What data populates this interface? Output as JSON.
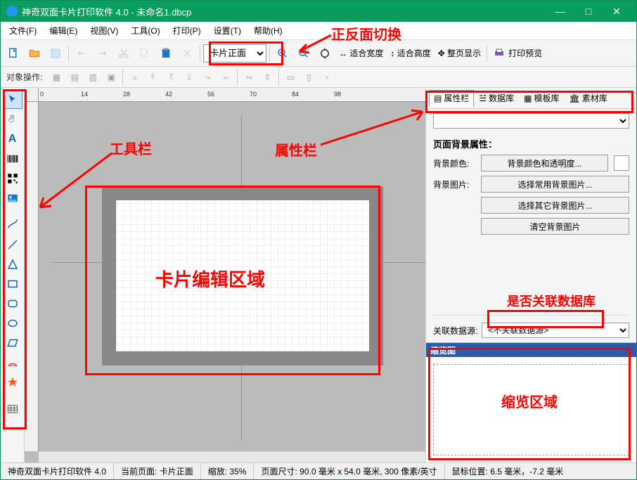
{
  "title": "神奇双面卡片打印软件 4.0 - 未命名1.dbcp",
  "menus": [
    "文件(F)",
    "编辑(E)",
    "视图(V)",
    "工具(O)",
    "打印(P)",
    "设置(T)",
    "帮助(H)"
  ],
  "toolbar": {
    "face_select": "卡片正面",
    "fit_width": "适合宽度",
    "fit_height": "适合高度",
    "full_page": "整页显示",
    "print_preview": "打印预览"
  },
  "obj_ops_label": "对象操作:",
  "side_tabs": {
    "props": "属性栏",
    "db": "数据库",
    "tpl": "模板库",
    "res": "素材库"
  },
  "props": {
    "section_title": "页面背景属性：",
    "bg_color_label": "背景颜色:",
    "bg_color_btn": "背景颜色和透明度...",
    "bg_img_label": "背景图片:",
    "bg_img_btn1": "选择常用背景图片...",
    "bg_img_btn2": "选择其它背景图片...",
    "bg_img_btn3": "清空背景图片"
  },
  "assoc": {
    "label": "关联数据源:",
    "value": "<不关联数据源>"
  },
  "thumb": {
    "header": "缩览图"
  },
  "annotations": {
    "face_switch": "正反面切换",
    "toolbar": "工具栏",
    "props_panel": "属性栏",
    "edit_area": "卡片编辑区域",
    "assoc_db": "是否关联数据库",
    "thumb_area": "缩览区域"
  },
  "ruler_ticks": [
    "0",
    "14",
    "28",
    "42",
    "56",
    "70",
    "84",
    "98"
  ],
  "status": {
    "app": "神奇双面卡片打印软件 4.0",
    "current_page_label": "当前页面:",
    "current_page": "卡片正面",
    "zoom_label": "缩放:",
    "zoom": "35%",
    "page_size_label": "页面尺寸:",
    "page_size": "90.0 毫米 x 54.0 毫米, 300 像素/英寸",
    "mouse_label": "鼠标位置:",
    "mouse": "6.5 毫米，-7.2 毫米"
  }
}
